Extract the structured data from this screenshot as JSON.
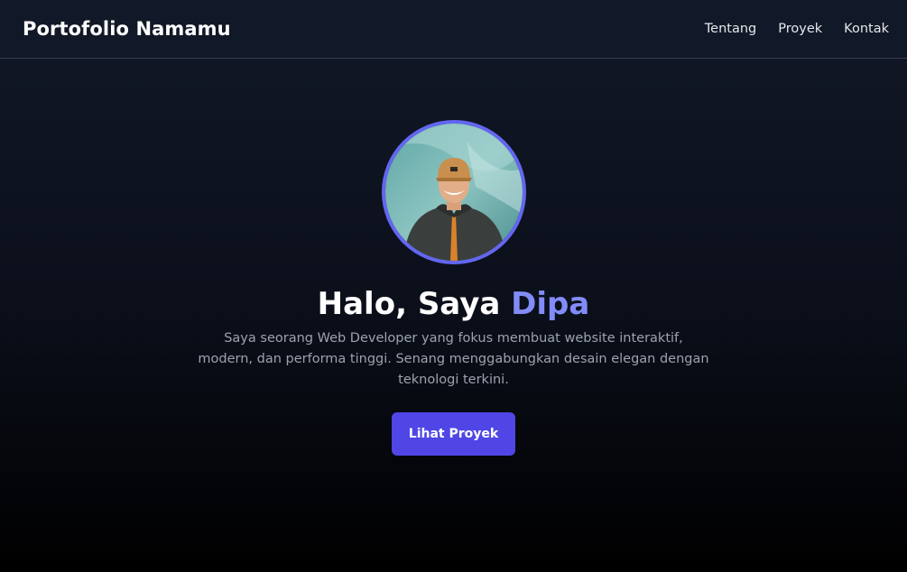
{
  "nav": {
    "brand": "Portofolio Namamu",
    "links": [
      "Tentang",
      "Proyek",
      "Kontak"
    ]
  },
  "hero": {
    "greeting": "Halo, Saya",
    "name": "Dipa",
    "description": "Saya seorang Web Developer yang fokus membuat website interaktif, modern, dan performa tinggi. Senang menggabungkan desain elegan dengan teknologi terkini.",
    "cta_label": "Lihat Proyek"
  },
  "colors": {
    "accent": "#6366f1",
    "name_accent": "#818cf8",
    "button": "#4f46e5",
    "navbar_bg": "#111827",
    "body_text": "#9ca3af"
  }
}
